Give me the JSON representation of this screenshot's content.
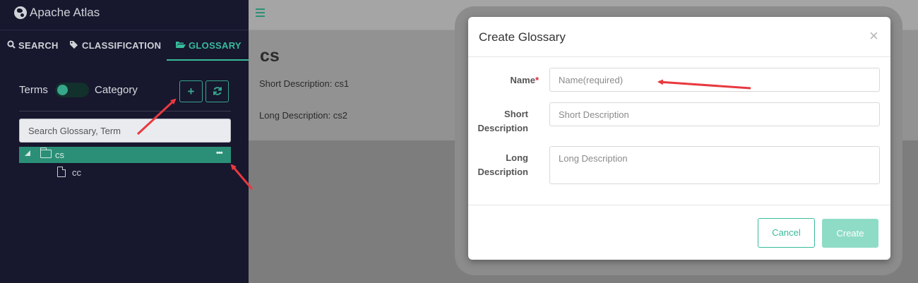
{
  "brand": {
    "title": "Apache Atlas",
    "icon": "globe-icon"
  },
  "tabs": [
    {
      "label": "SEARCH",
      "icon": "search-icon"
    },
    {
      "label": "CLASSIFICATION",
      "icon": "tags-icon"
    },
    {
      "label": "GLOSSARY",
      "icon": "folder-open-icon",
      "active": true
    }
  ],
  "sidebar": {
    "toggle": {
      "left_label": "Terms",
      "right_label": "Category"
    },
    "add_button": "+",
    "refresh_icon": "refresh-icon",
    "search_placeholder": "Search Glossary, Term",
    "tree": {
      "selected": {
        "label": "cs",
        "more": "•••"
      },
      "child": {
        "label": "cc"
      }
    }
  },
  "content": {
    "title": "cs",
    "short_description": "Short Description: cs1",
    "long_description": "Long Description: cs2"
  },
  "modal": {
    "title": "Create Glossary",
    "close": "×",
    "fields": {
      "name_label": "Name",
      "required_mark": "*",
      "name_placeholder": "Name(required)",
      "short_label_1": "Short",
      "short_label_2": "Description",
      "short_placeholder": "Short Description",
      "long_label_1": "Long",
      "long_label_2": "Description",
      "long_placeholder": "Long Description"
    },
    "cancel_label": "Cancel",
    "create_label": "Create"
  },
  "colors": {
    "accent": "#38bb9b",
    "sidebar_bg": "#17172e",
    "annotation": "#e8393f"
  }
}
